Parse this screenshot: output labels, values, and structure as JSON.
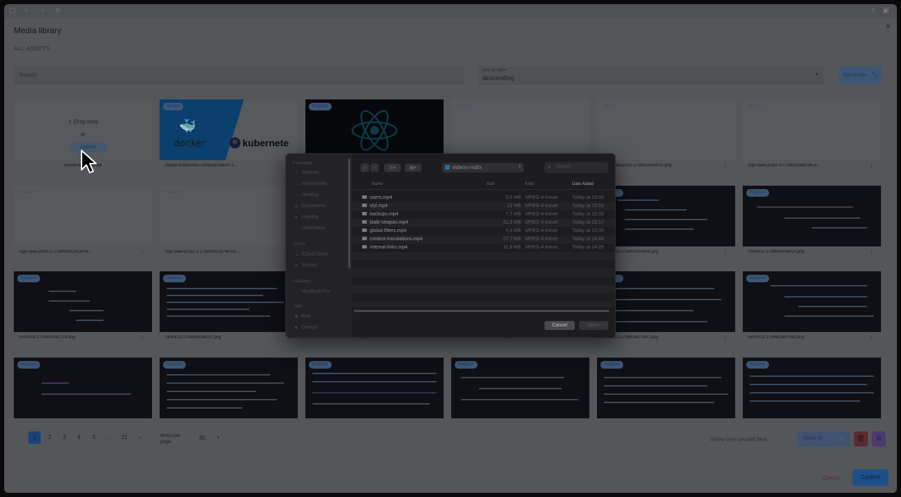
{
  "browser": {
    "url": ""
  },
  "page": {
    "title": "Media library",
    "breadcrumb": "ALL ASSETS",
    "search_placeholder": "Search",
    "sort": {
      "label": "Sort by name",
      "value": "descending"
    },
    "generate_label": "Generate"
  },
  "dropzone": {
    "drop": "Drop here",
    "or": "or",
    "upload": "Upload",
    "file": "conversion-to-.webp"
  },
  "cards": [
    {
      "badge": "devops",
      "file": "docker-kubernetes-containerization-1...",
      "docker": "docker",
      "kube": "kubernete"
    },
    {
      "badge": "blogpost",
      "file": ""
    },
    {
      "badge": "brands",
      "file": ""
    },
    {
      "badge": "brands",
      "file": "logo-biale-przez-1739910409201.png"
    },
    {
      "badge": "brands",
      "file": "logo-biale-przez-3-1739910383785.w..."
    },
    {
      "badge": "brands",
      "file": "logo-biale-przez-2-1739910314139.w..."
    },
    {
      "badge": "brands",
      "file": "logo-biale-przez-1-1739910218766.we..."
    },
    {
      "badge": "blogpost",
      "file": "mmmr26-1739904254836.png"
    },
    {
      "badge": "blogpost",
      "file": "mmmr25-1739904248620.png"
    },
    {
      "badge": "blogpost",
      "file": "mmmr24-1739904242714.png"
    },
    {
      "badge": "blogpost",
      "file": "mmmr23-1739904236297.png"
    },
    {
      "badge": "blogpost",
      "file": "mmmr22-1739904229902.png"
    },
    {
      "badge": "blogpost",
      "file": "mmmr21-1739904223901.png"
    },
    {
      "badge": "blogpost",
      "file": "mmmr20-1739903873847.png"
    },
    {
      "badge": "blogpost",
      "file": "mmmr19-1739903867091.png"
    },
    {
      "badge": "blogpost"
    },
    {
      "badge": "blogpost"
    },
    {
      "badge": "blogpost"
    },
    {
      "badge": "blogpost"
    },
    {
      "badge": "blogpost"
    },
    {
      "badge": "blogpost"
    }
  ],
  "pagination": {
    "pages": [
      "1",
      "2",
      "3",
      "4",
      "5",
      "...",
      "21"
    ],
    "next": "›",
    "ipp_label": "Items per page",
    "ipp_value": "35"
  },
  "footer": {
    "unused_label": "Show only unused files",
    "select_label": "Select all",
    "cancel": "Cancel",
    "confirm": "Confirm"
  },
  "dialog": {
    "sidebar": [
      {
        "section": "Favourites"
      },
      {
        "item": "Recents"
      },
      {
        "item": "meduzajobs"
      },
      {
        "item": "Desktop"
      },
      {
        "item": "Documents"
      },
      {
        "item": "projekty"
      },
      {
        "item": "Downloads"
      },
      {
        "section": "iCloud"
      },
      {
        "item": "iCloud Drive"
      },
      {
        "item": "Shared"
      },
      {
        "section": "Locations"
      },
      {
        "item": "MacBook Pro"
      },
      {
        "section": "Tags"
      },
      {
        "item": "Red"
      },
      {
        "item": "Orange"
      }
    ],
    "folder": "videos-mdtx",
    "search_placeholder": "Search",
    "columns": {
      "name": "Name",
      "size": "Size",
      "kind": "Kind",
      "date": "Date Added"
    },
    "files": [
      {
        "name": "users.mp4",
        "size": "3,6 MB",
        "kind": "MPEG-4 movie",
        "date": "Today at 16:08"
      },
      {
        "name": "styl.mp4",
        "size": "13 MB",
        "kind": "MPEG-4 movie",
        "date": "Today at 15:59"
      },
      {
        "name": "backups.mp4",
        "size": "7,7 MB",
        "kind": "MPEG-4 movie",
        "date": "Today at 15:33"
      },
      {
        "name": "biale-strapas.mp4",
        "size": "31,3 MB",
        "kind": "MPEG-4 movie",
        "date": "Today at 15:17"
      },
      {
        "name": "global-filters.mp4",
        "size": "9,4 MB",
        "kind": "MPEG-4 movie",
        "date": "Today at 15:00"
      },
      {
        "name": "content-translations.mp4",
        "size": "27,7 MB",
        "kind": "MPEG-4 movie",
        "date": "Today at 14:48"
      },
      {
        "name": "internal-links.mp4",
        "size": "11,8 MB",
        "kind": "MPEG-4 movie",
        "date": "Today at 14:28"
      }
    ],
    "cancel": "Cancel",
    "open": "Open"
  }
}
